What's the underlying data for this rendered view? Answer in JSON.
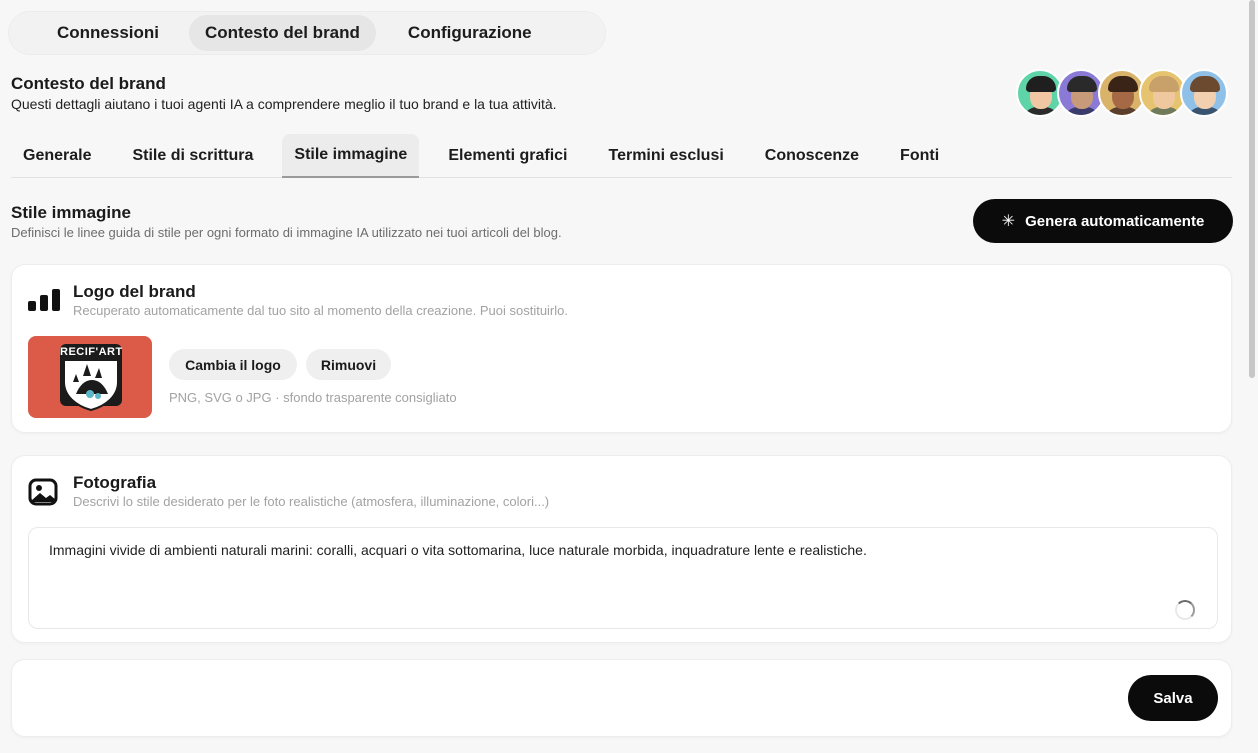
{
  "top_tabs": [
    {
      "label": "Connessioni"
    },
    {
      "label": "Contesto del brand",
      "active": true
    },
    {
      "label": "Configurazione"
    }
  ],
  "header": {
    "title": "Contesto del brand",
    "subtitle": "Questi dettagli aiutano i tuoi agenti IA a comprendere meglio il tuo brand e la tua attività."
  },
  "avatars": [
    {
      "name": "agent-1",
      "bg": "#5fd4a8"
    },
    {
      "name": "agent-2",
      "bg": "#8a7ad6"
    },
    {
      "name": "agent-3",
      "bg": "#d9b36a"
    },
    {
      "name": "agent-4",
      "bg": "#e6c46f"
    },
    {
      "name": "agent-5",
      "bg": "#8fc1e8"
    }
  ],
  "sub_tabs": [
    {
      "label": "Generale"
    },
    {
      "label": "Stile di scrittura"
    },
    {
      "label": "Stile immagine",
      "active": true
    },
    {
      "label": "Elementi grafici"
    },
    {
      "label": "Termini esclusi"
    },
    {
      "label": "Conoscenze"
    },
    {
      "label": "Fonti"
    }
  ],
  "section": {
    "title": "Stile immagine",
    "subtitle": "Definisci le linee guida di stile per ogni formato di immagine IA utilizzato nei tuoi articoli del blog.",
    "generate_button": "Genera automaticamente",
    "generate_icon": "sparkle-icon"
  },
  "logo_card": {
    "icon": "bar-chart-icon",
    "title": "Logo del brand",
    "subtitle": "Recuperato automaticamente dal tuo sito al momento della creazione. Puoi sostituirlo.",
    "logo_text": "RECIF'ART",
    "change_label": "Cambia il logo",
    "remove_label": "Rimuovi",
    "hint": "PNG, SVG o JPG · sfondo trasparente consigliato"
  },
  "photo_card": {
    "icon": "image-icon",
    "title": "Fotografia",
    "subtitle": "Descrivi lo stile desiderato per le foto realistiche (atmosfera, illuminazione, colori...)",
    "value": "Immagini vivide di ambienti naturali marini: coralli, acquari o vita sottomarina, luce naturale morbida, inquadrature lente e realistiche."
  },
  "footer": {
    "save_label": "Salva"
  },
  "colors": {
    "accent": "#0b0b0b",
    "logo_bg": "#dc5a48"
  }
}
